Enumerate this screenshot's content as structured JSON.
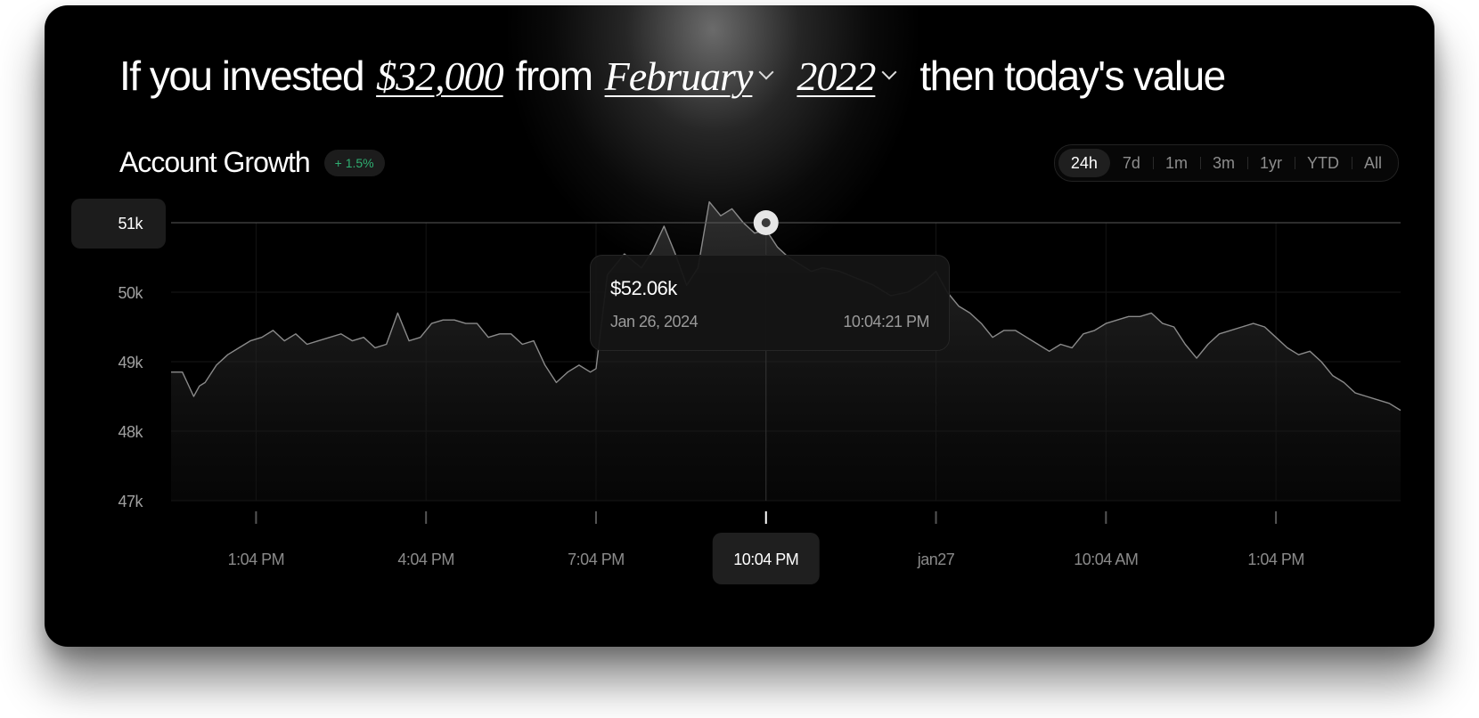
{
  "headline": {
    "prefix": "If you invested",
    "amount": "$32,000",
    "from_word": "from",
    "month": "February",
    "year": "2022",
    "suffix": "then today's value"
  },
  "section": {
    "title": "Account Growth",
    "change_badge": "+ 1.5%"
  },
  "ranges": [
    "24h",
    "7d",
    "1m",
    "3m",
    "1yr",
    "YTD",
    "All"
  ],
  "active_range": "24h",
  "colors": {
    "background": "#000000",
    "accent_positive": "#2fb072",
    "line": "#8a8a8a",
    "text_primary": "#ffffff",
    "text_muted": "#9a9a9a"
  },
  "tooltip": {
    "value": "$52.06k",
    "date": "Jan 26, 2024",
    "time": "10:04:21 PM"
  },
  "chart_data": {
    "type": "area",
    "y_ticks": [
      "47k",
      "48k",
      "49k",
      "50k",
      "51k"
    ],
    "y_tick_values": [
      47000,
      48000,
      49000,
      50000,
      51000
    ],
    "ylim": [
      47000,
      51000
    ],
    "x_ticks": [
      "1:04 PM",
      "4:04 PM",
      "7:04 PM",
      "10:04 PM",
      "jan27",
      "10:04 AM",
      "1:04 PM"
    ],
    "x_tick_positions": [
      1,
      4,
      7,
      10,
      13,
      16,
      19
    ],
    "xlim": [
      -0.5,
      21.2
    ],
    "highlight_x_tick": 3,
    "highlight_y_value": 51000,
    "highlight_y_label": "51k",
    "grid": true,
    "series": [
      {
        "x": [
          -0.5,
          -0.3,
          -0.1,
          0.0,
          0.1,
          0.3,
          0.5,
          0.7,
          0.9,
          1.1,
          1.3,
          1.5,
          1.7,
          1.9,
          2.1,
          2.3,
          2.5,
          2.7,
          2.9,
          3.1,
          3.3,
          3.5,
          3.7,
          3.9,
          4.1,
          4.3,
          4.5,
          4.7,
          4.9,
          5.1,
          5.3,
          5.5,
          5.7,
          5.9,
          6.1,
          6.3,
          6.5,
          6.7,
          6.9,
          7.0,
          7.2,
          7.5,
          7.8,
          8.0,
          8.2,
          8.4,
          8.6,
          8.8,
          9.0,
          9.2,
          9.4,
          9.6,
          9.8,
          10.0,
          10.2,
          10.4,
          10.6,
          10.8,
          11.0,
          11.3,
          11.6,
          11.9,
          12.2,
          12.5,
          12.8,
          13.0,
          13.2,
          13.4,
          13.6,
          13.8,
          14.0,
          14.2,
          14.4,
          14.6,
          14.8,
          15.0,
          15.2,
          15.4,
          15.6,
          15.8,
          16.0,
          16.2,
          16.4,
          16.6,
          16.8,
          17.0,
          17.2,
          17.4,
          17.6,
          17.8,
          18.0,
          18.2,
          18.4,
          18.6,
          18.8,
          19.0,
          19.2,
          19.4,
          19.6,
          19.8,
          20.0,
          20.2,
          20.4,
          20.6,
          20.8,
          21.0,
          21.2
        ],
        "y": [
          48.85,
          48.85,
          48.5,
          48.65,
          48.7,
          48.95,
          49.1,
          49.2,
          49.3,
          49.35,
          49.45,
          49.3,
          49.4,
          49.25,
          49.3,
          49.35,
          49.4,
          49.3,
          49.35,
          49.2,
          49.25,
          49.7,
          49.3,
          49.35,
          49.55,
          49.6,
          49.6,
          49.55,
          49.55,
          49.35,
          49.4,
          49.4,
          49.25,
          49.3,
          48.95,
          48.7,
          48.85,
          48.95,
          48.85,
          48.9,
          50.25,
          50.55,
          50.35,
          50.6,
          50.95,
          50.55,
          50.1,
          50.35,
          51.3,
          51.1,
          51.2,
          51.0,
          50.85,
          50.9,
          50.65,
          50.5,
          50.4,
          50.3,
          50.35,
          50.3,
          50.2,
          50.1,
          49.95,
          50.0,
          50.15,
          50.3,
          50.0,
          49.8,
          49.7,
          49.55,
          49.35,
          49.45,
          49.45,
          49.35,
          49.25,
          49.15,
          49.25,
          49.2,
          49.4,
          49.45,
          49.55,
          49.6,
          49.65,
          49.65,
          49.7,
          49.55,
          49.5,
          49.25,
          49.05,
          49.25,
          49.4,
          49.45,
          49.5,
          49.55,
          49.5,
          49.35,
          49.2,
          49.1,
          49.15,
          49.0,
          48.8,
          48.7,
          48.55,
          48.5,
          48.45,
          48.4,
          48.3
        ],
        "y_unit": "thousand USD"
      }
    ]
  }
}
